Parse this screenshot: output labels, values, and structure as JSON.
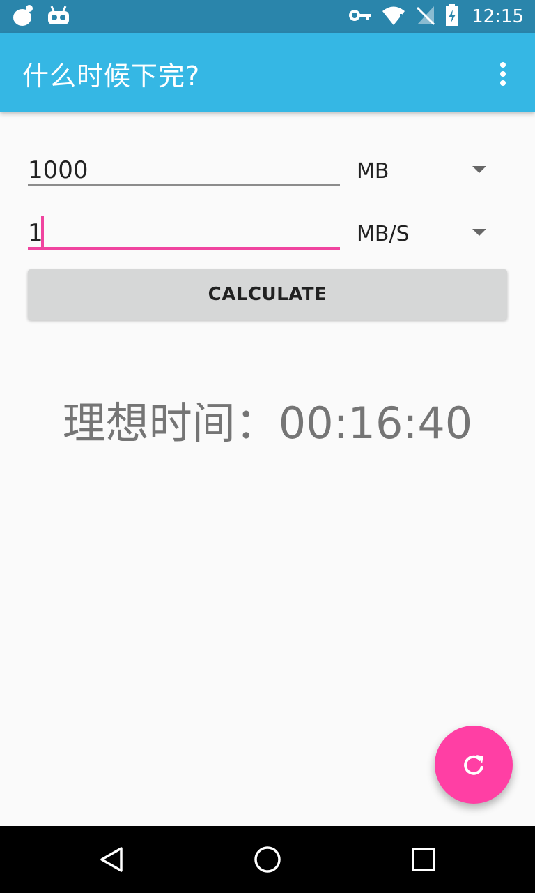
{
  "status_bar": {
    "time": "12:15",
    "left_icons": [
      "android-icon",
      "cyanogen-bot-icon"
    ],
    "right_icons": [
      "vpn-key-icon",
      "wifi-icon",
      "signal-icon",
      "battery-charging-icon"
    ]
  },
  "app_bar": {
    "title": "什么时候下完?"
  },
  "form": {
    "size_value": "1000",
    "size_unit": "MB",
    "speed_value": "1",
    "speed_unit": "MB/S",
    "calculate_label": "CALCULATE"
  },
  "result": {
    "text": "理想时间：00:16:40"
  },
  "colors": {
    "status_bar": "#2a85ab",
    "app_bar": "#35b7e4",
    "accent": "#f0449f",
    "fab": "#ff3fa4",
    "button": "#d6d7d7"
  }
}
